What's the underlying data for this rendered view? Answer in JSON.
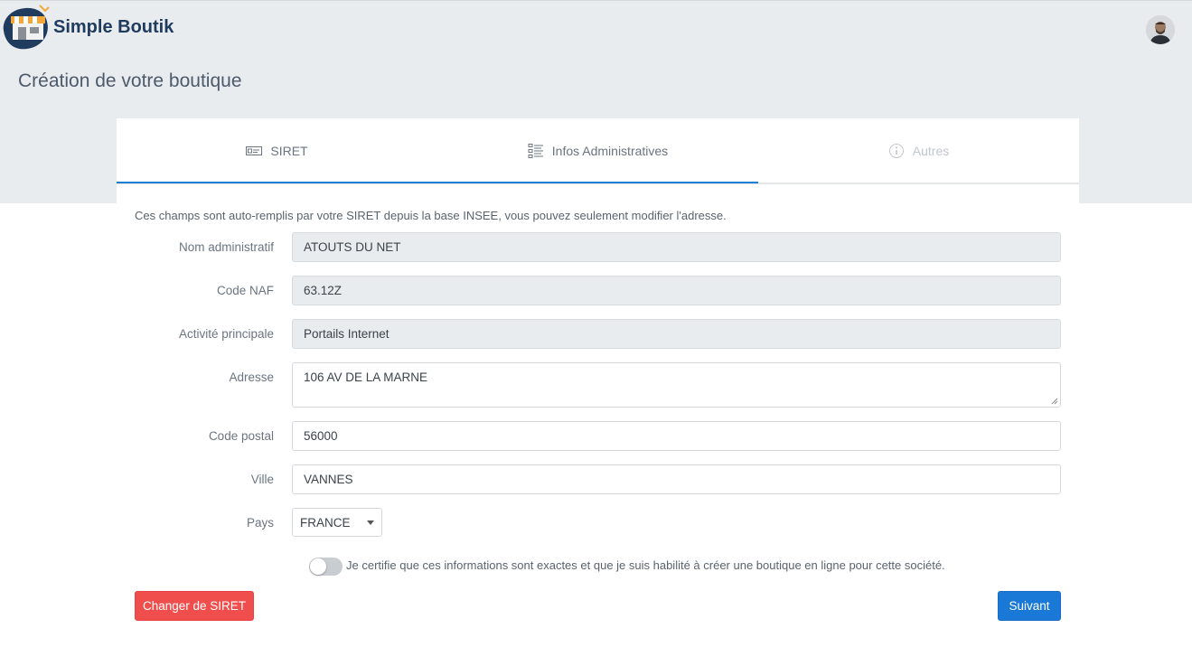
{
  "header": {
    "brand": "Simple Boutik",
    "page_title": "Création de votre boutique"
  },
  "tabs": [
    {
      "label": "SIRET",
      "icon": "id-card-icon",
      "state": "done"
    },
    {
      "label": "Infos Administratives",
      "icon": "list-icon",
      "state": "active"
    },
    {
      "label": "Autres",
      "icon": "info-icon",
      "state": "disabled"
    }
  ],
  "form": {
    "intro": "Ces champs sont auto-remplis par votre SIRET depuis la base INSEE, vous pouvez seulement modifier l'adresse.",
    "nom_label": "Nom administratif",
    "nom_value": "ATOUTS DU NET",
    "naf_label": "Code NAF",
    "naf_value": "63.12Z",
    "activite_label": "Activité principale",
    "activite_value": "Portails Internet",
    "adresse_label": "Adresse",
    "adresse_value": "106 AV DE LA MARNE",
    "cp_label": "Code postal",
    "cp_value": "56000",
    "ville_label": "Ville",
    "ville_value": "VANNES",
    "pays_label": "Pays",
    "pays_value": "FRANCE",
    "certify_text": "Je certifie que ces informations sont exactes et que je suis habilité à créer une boutique en ligne pour cette société.",
    "certify_checked": false
  },
  "actions": {
    "change_siret": "Changer de SIRET",
    "next": "Suivant"
  },
  "colors": {
    "accent": "#1a78d6",
    "danger": "#f04d4d",
    "header_bg": "#e9ecef",
    "brand": "#1f3b5e"
  }
}
